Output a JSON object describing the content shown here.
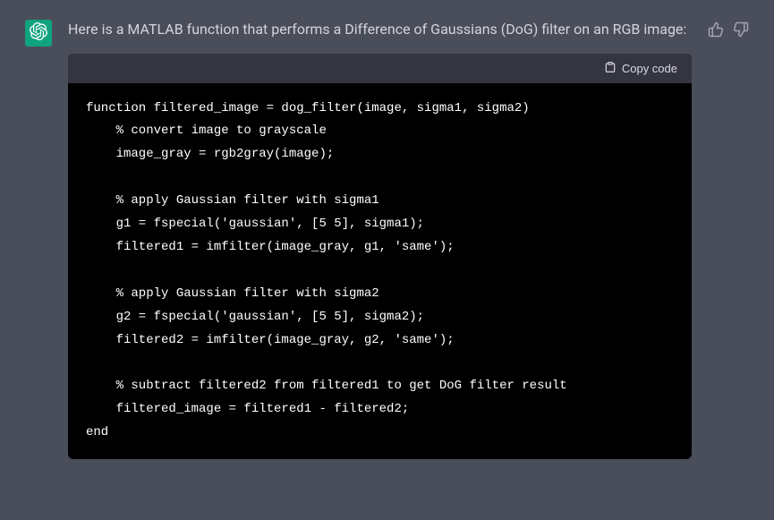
{
  "message": {
    "text": "Here is a MATLAB function that performs a Difference of Gaussians (DoG) filter on an RGB image:"
  },
  "code_block": {
    "copy_label": "Copy code",
    "code": "function filtered_image = dog_filter(image, sigma1, sigma2)\n    % convert image to grayscale\n    image_gray = rgb2gray(image);\n\n    % apply Gaussian filter with sigma1\n    g1 = fspecial('gaussian', [5 5], sigma1);\n    filtered1 = imfilter(image_gray, g1, 'same');\n\n    % apply Gaussian filter with sigma2\n    g2 = fspecial('gaussian', [5 5], sigma2);\n    filtered2 = imfilter(image_gray, g2, 'same');\n\n    % subtract filtered2 from filtered1 to get DoG filter result\n    filtered_image = filtered1 - filtered2;\nend"
  }
}
